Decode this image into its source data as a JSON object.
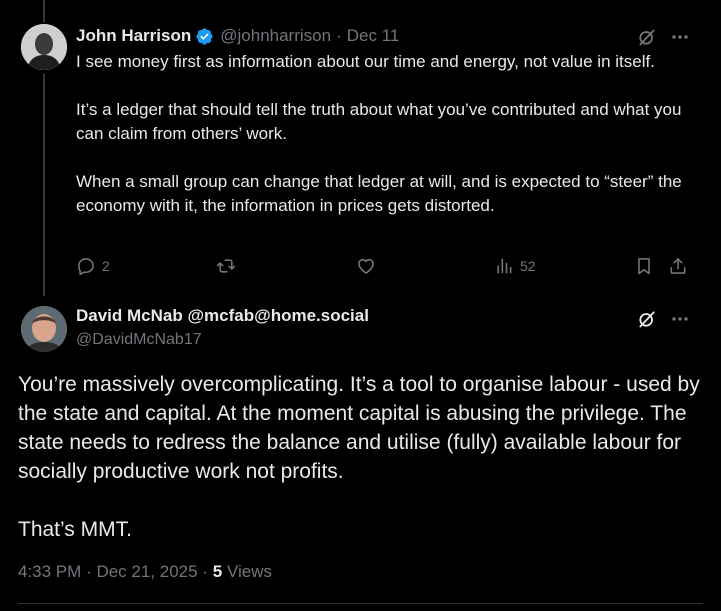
{
  "colors": {
    "background": "#000000",
    "text_primary": "#e7e9ea",
    "text_secondary": "#71767b",
    "verified_blue": "#1d9bf0",
    "thread_line": "#333639"
  },
  "tweet1": {
    "display_name": "John Harrison",
    "verified": true,
    "handle": "@johnharrison",
    "separator": "·",
    "date": "Dec 11",
    "avatar_icon": "avatar-icon",
    "grok_icon": "grok-icon",
    "more_icon": "more-icon",
    "paragraphs": [
      "I see money first as information about our time and energy, not value in itself.",
      "It’s a ledger that should tell the truth about what you’ve contributed and what you can claim from others’ work.",
      "When a small group can change that ledger at will, and is expected to “steer” the economy with it, the information in prices gets distorted."
    ],
    "actions": {
      "reply_icon": "reply-icon",
      "reply_count": "2",
      "retweet_icon": "retweet-icon",
      "like_icon": "like-icon",
      "views_icon": "views-icon",
      "views_count": "52",
      "bookmark_icon": "bookmark-icon",
      "share_icon": "share-icon"
    }
  },
  "tweet2": {
    "display_name": "David McNab @mcfab@home.social",
    "handle": "@DavidMcNab17",
    "avatar_icon": "avatar-icon",
    "grok_icon": "grok-icon",
    "more_icon": "more-icon",
    "paragraphs": [
      "You’re massively overcomplicating. It’s a tool to organise labour - used by the state and capital. At the moment capital is abusing the privilege. The state needs to redress the balance and utilise (fully) available labour for socially productive work not profits.",
      "That’s MMT."
    ],
    "meta": {
      "time": "4:33 PM",
      "separator1": "·",
      "date": "Dec 21, 2025",
      "separator2": "·",
      "views_count": "5",
      "views_label": "Views"
    }
  }
}
